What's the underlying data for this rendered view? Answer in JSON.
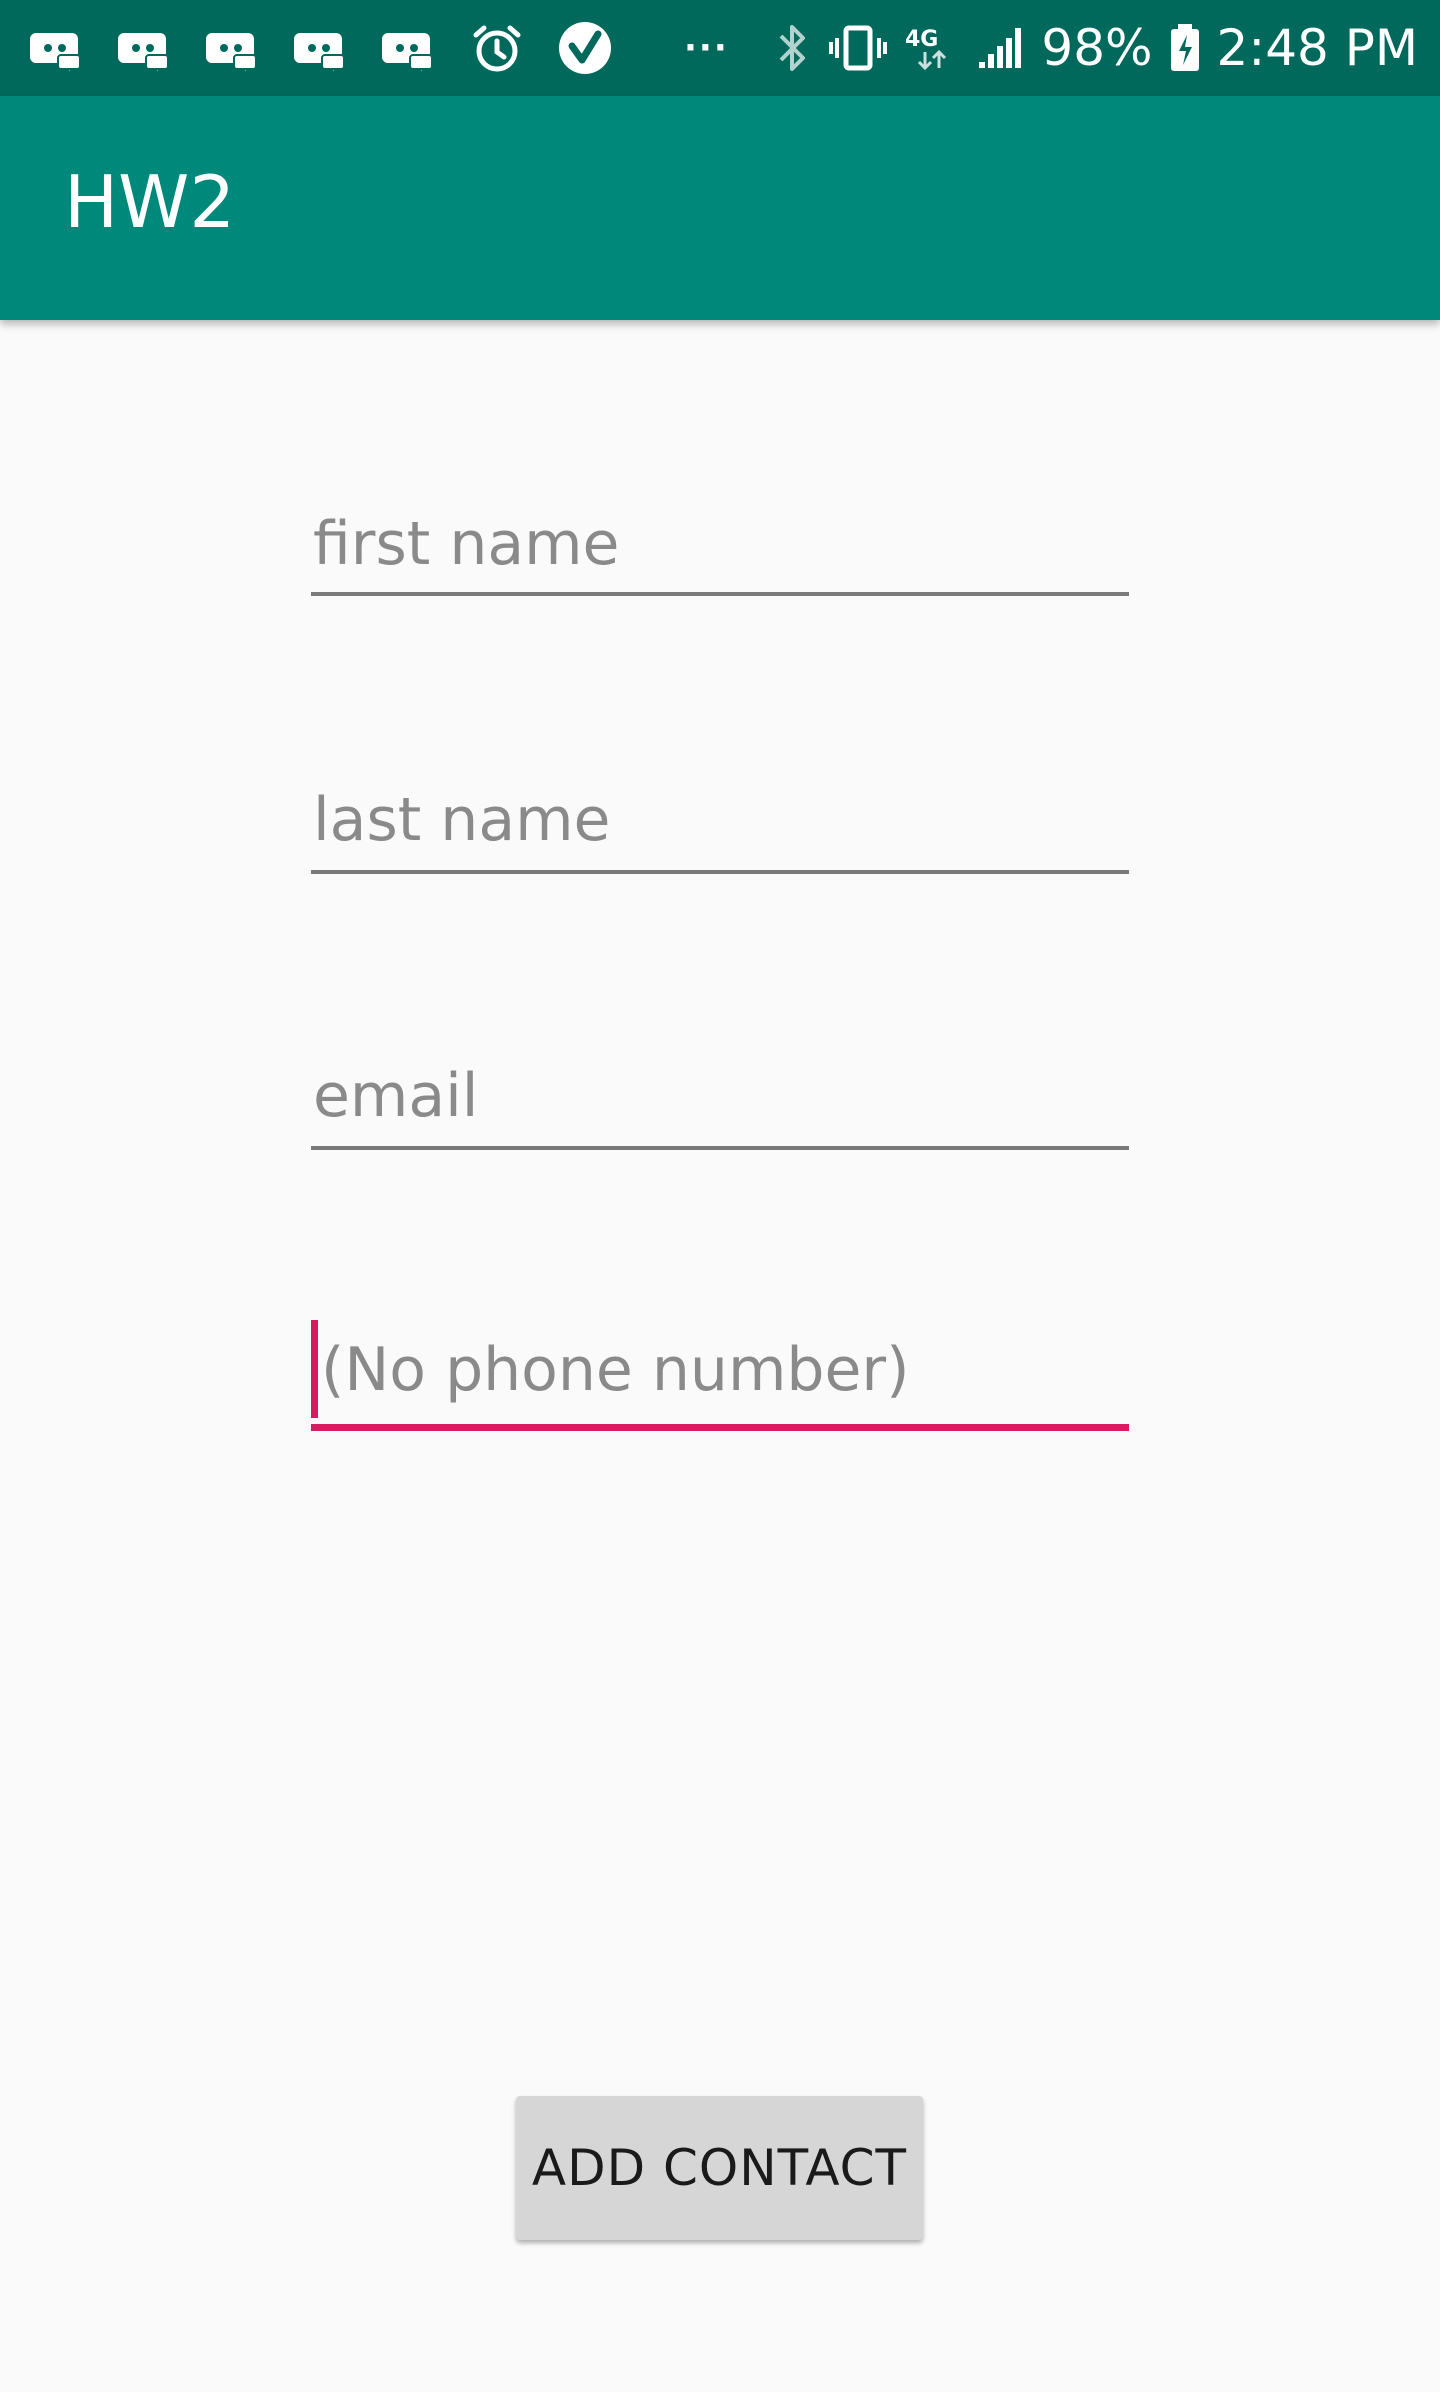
{
  "status_bar": {
    "left_icons": [
      "discord-icon",
      "discord-icon",
      "discord-icon",
      "discord-icon",
      "discord-icon",
      "alarm-clock-icon",
      "checkmark-circle-icon"
    ],
    "overflow": "···",
    "right_icons": [
      "bluetooth-icon",
      "vibrate-icon",
      "lte-4g-icon",
      "signal-icon",
      "battery-charging-icon"
    ],
    "network_type": "4G",
    "battery": "98%",
    "time": "2:48 PM"
  },
  "app_bar": {
    "title": "HW2",
    "color": "#00897b",
    "status_color": "#00695c"
  },
  "form": {
    "first_name": {
      "placeholder": "first name",
      "value": ""
    },
    "last_name": {
      "placeholder": "last name",
      "value": ""
    },
    "email": {
      "placeholder": "email",
      "value": ""
    },
    "phone": {
      "placeholder": "(No phone number)",
      "value": "",
      "focused": true
    },
    "accent_color": "#d81b60"
  },
  "add_button": {
    "label": "ADD CONTACT"
  }
}
